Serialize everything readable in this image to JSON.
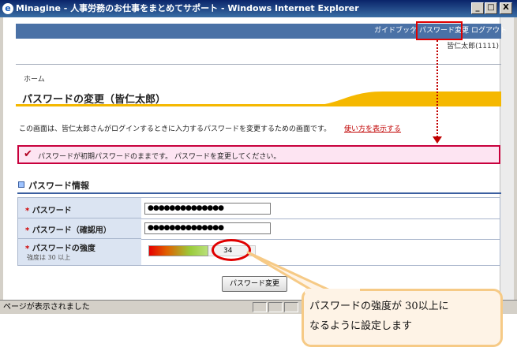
{
  "window": {
    "title": "Minagine - 人事労務のお仕事をまとめてサポート - Windows Internet Explorer",
    "app_icon": "e",
    "controls": [
      "_",
      "□",
      "X"
    ]
  },
  "nav": {
    "guidebook": "ガイドブック",
    "password_change": "パスワード変更",
    "logout": "ログアウト",
    "separator": "|"
  },
  "user": {
    "name": "皆仁太郎(1111)"
  },
  "breadcrumb": "ホーム",
  "page_title": "パスワードの変更（皆仁太郎）",
  "intro": {
    "text": "この画面は、皆仁太郎さんがログインするときに入力するパスワードを変更するための画面です。",
    "help_link": "使い方を表示する"
  },
  "alert": {
    "icon": "check-icon",
    "text": "パスワードが初期パスワードのままです。 パスワードを変更してください。"
  },
  "section": {
    "title": "パスワード情報"
  },
  "form": {
    "required_mark": "*",
    "password_label": "パスワード",
    "password_value": "●●●●●●●●●●●●●●",
    "confirm_label": "パスワード（確認用）",
    "confirm_value": "●●●●●●●●●●●●●●",
    "strength_label": "パスワードの強度",
    "strength_hint": "強度は 30 以上",
    "strength_value": "34",
    "submit_label": "パスワード変更"
  },
  "status": {
    "text": "ページが表示されました"
  },
  "callout": {
    "line1": "パスワードの強度が 30以上に",
    "line2": "なるように設定します"
  },
  "colors": {
    "nav_bg": "#4a71a6",
    "alert_border": "#c8003c",
    "alert_bg": "#fde4f2",
    "highlight_red": "#e00000",
    "callout_border": "#f6ca86",
    "title_accent": "#f5b800"
  }
}
